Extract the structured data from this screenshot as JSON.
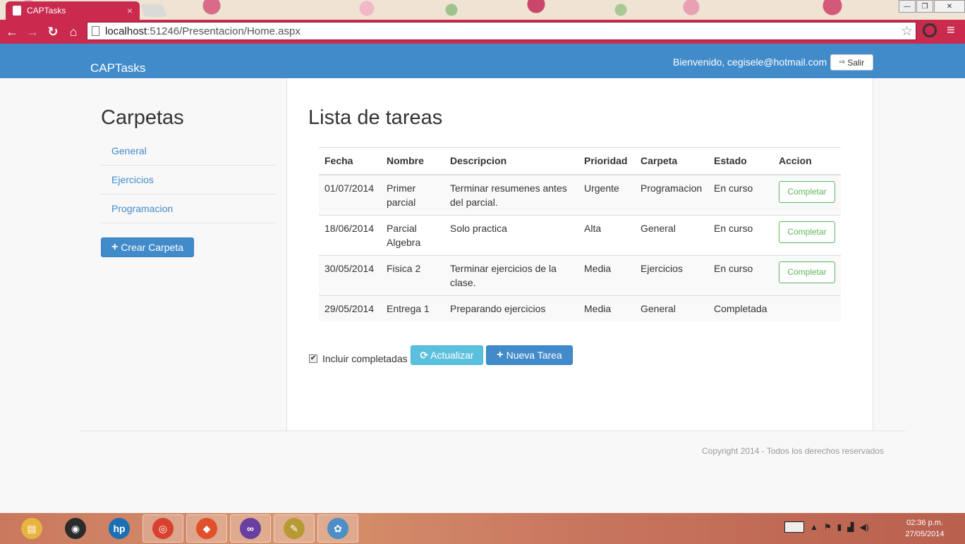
{
  "browser": {
    "tab_title": "CAPTasks",
    "tab_close": "×",
    "url_host": "localhost",
    "url_rest": ":51246/Presentacion/Home.aspx",
    "bookmark_star": "☆",
    "menu": "≡",
    "back": "←",
    "forward": "→",
    "reload": "↻",
    "home": "⌂",
    "minimize": "—",
    "restore": "❐",
    "close": "✕"
  },
  "navbar": {
    "brand": "CAPTasks",
    "welcome": "Bienvenido, cegisele@hotmail.com",
    "logout_icon": "⇨",
    "logout_label": "Salir"
  },
  "sidebar": {
    "title": "Carpetas",
    "folders": [
      "General",
      "Ejercicios",
      "Programacion"
    ],
    "create_icon": "+",
    "create_label": "Crear Carpeta"
  },
  "main": {
    "title": "Lista de tareas",
    "columns": [
      "Fecha",
      "Nombre",
      "Descripcion",
      "Prioridad",
      "Carpeta",
      "Estado",
      "Accion"
    ],
    "rows": [
      {
        "fecha": "01/07/2014",
        "nombre": "Primer parcial",
        "descripcion": "Terminar resumenes antes del parcial.",
        "prioridad": "Urgente",
        "carpeta": "Programacion",
        "estado": "En curso",
        "accion": "Completar"
      },
      {
        "fecha": "18/06/2014",
        "nombre": "Parcial Algebra",
        "descripcion": "Solo practica",
        "prioridad": "Alta",
        "carpeta": "General",
        "estado": "En curso",
        "accion": "Completar"
      },
      {
        "fecha": "30/05/2014",
        "nombre": "Fisica 2",
        "descripcion": "Terminar ejercicios de la clase.",
        "prioridad": "Media",
        "carpeta": "Ejercicios",
        "estado": "En curso",
        "accion": "Completar"
      },
      {
        "fecha": "29/05/2014",
        "nombre": "Entrega 1",
        "descripcion": "Preparando ejercicios",
        "prioridad": "Media",
        "carpeta": "General",
        "estado": "Completada",
        "accion": ""
      }
    ],
    "include_completed_label": "Incluir completadas",
    "include_completed_checked": "✔",
    "refresh_icon": "⟳",
    "refresh_label": "Actualizar",
    "new_task_icon": "+",
    "new_task_label": "Nueva Tarea"
  },
  "footer": {
    "text": "Copyright 2014 - Todos los derechos reservados"
  },
  "taskbar": {
    "apps": [
      {
        "name": "file-explorer",
        "glyph": "▤",
        "color": "#e8b440"
      },
      {
        "name": "media-player",
        "glyph": "◉",
        "color": "#2b2b2b"
      },
      {
        "name": "hp",
        "glyph": "hp",
        "color": "#1a6fb5"
      },
      {
        "name": "chrome",
        "glyph": "◎",
        "color": "#d9412f"
      },
      {
        "name": "git",
        "glyph": "◆",
        "color": "#e0502b"
      },
      {
        "name": "visual-studio",
        "glyph": "∞",
        "color": "#6a3fa0"
      },
      {
        "name": "tools",
        "glyph": "✎",
        "color": "#b89a35"
      },
      {
        "name": "paint",
        "glyph": "✿",
        "color": "#4c8ec6"
      }
    ],
    "time": "02:36 p.m.",
    "date": "27/05/2014"
  }
}
